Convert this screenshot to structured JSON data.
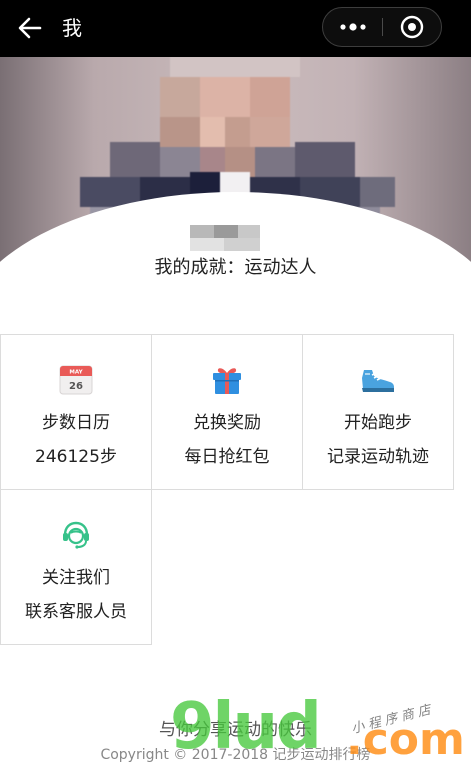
{
  "navbar": {
    "title": "我",
    "back_icon": "arrow-left-icon",
    "more_icon": "more-dots-icon",
    "close_icon": "target-circle-icon"
  },
  "profile": {
    "avatar": "pixelated-avatar",
    "achievement": "我的成就：运动达人"
  },
  "menu": [
    {
      "icon": "calendar-icon",
      "label": "步数日历",
      "sub": "246125步",
      "calendar_month": "MAY",
      "calendar_day": "26"
    },
    {
      "icon": "gift-icon",
      "label": "兑换奖励",
      "sub": "每日抢红包"
    },
    {
      "icon": "sneaker-icon",
      "label": "开始跑步",
      "sub": "记录运动轨迹"
    },
    {
      "icon": "headset-agent-icon",
      "label": "关注我们",
      "sub": "联系客服人员"
    }
  ],
  "footer": {
    "slogan": "与你分享运动的快乐",
    "copyright": "Copyright © 2017-2018 记步运动排行榜"
  },
  "watermark": {
    "main": "9lud",
    "com": ".com",
    "script": "小程序商店"
  },
  "colors": {
    "navbar_bg": "#000000",
    "calendar_red": "#e95a57",
    "gift_blue": "#2f8fe0",
    "sneaker_blue": "#4aa3df",
    "headset_green": "#36c28a"
  }
}
